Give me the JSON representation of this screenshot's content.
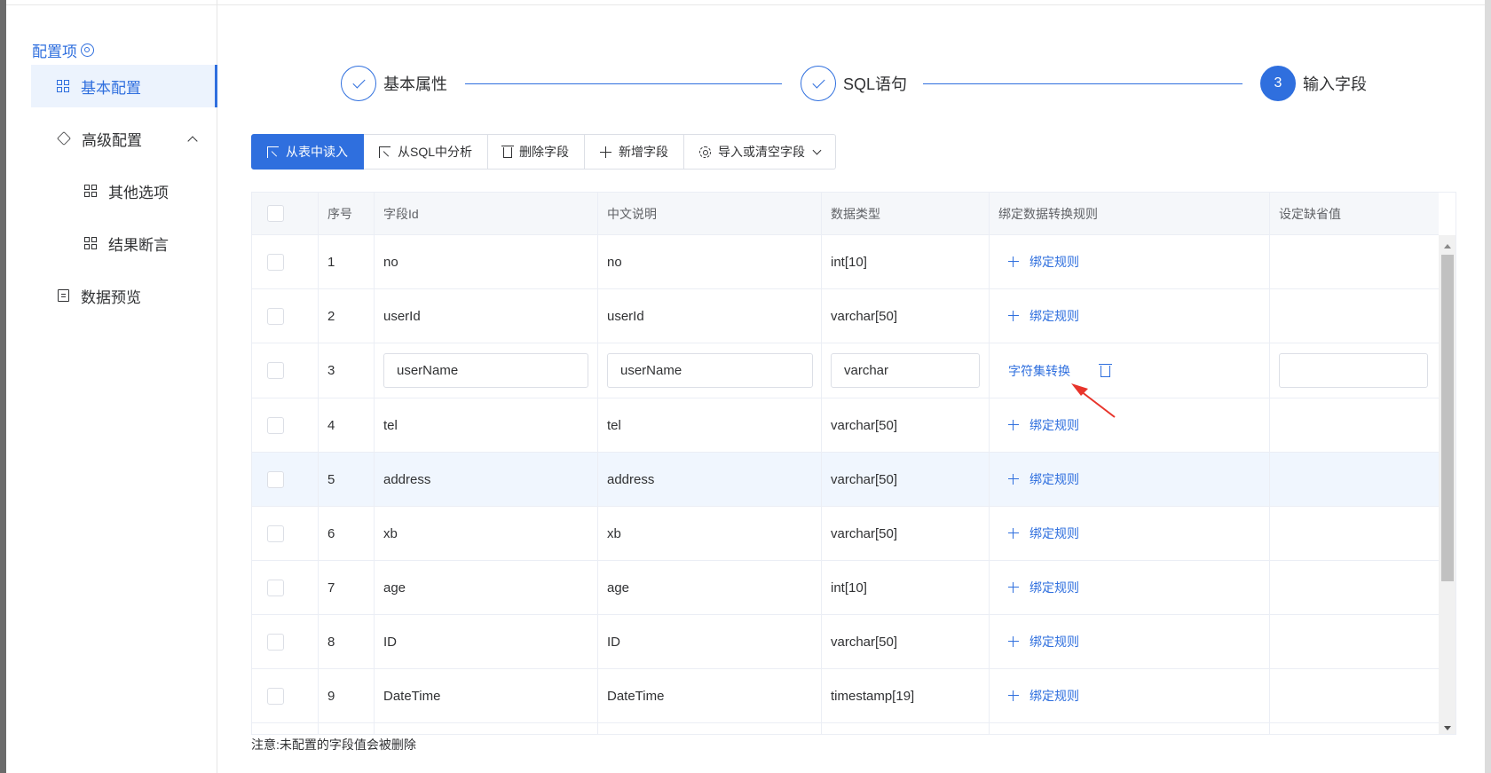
{
  "sidebar": {
    "title": "配置项",
    "items": [
      {
        "label": "基本配置"
      },
      {
        "label": "高级配置"
      },
      {
        "label": "其他选项"
      },
      {
        "label": "结果断言"
      },
      {
        "label": "数据预览"
      }
    ]
  },
  "steps": [
    {
      "label": "基本属性",
      "state": "done"
    },
    {
      "label": "SQL语句",
      "state": "done"
    },
    {
      "label": "输入字段",
      "state": "current",
      "number": "3"
    }
  ],
  "toolbar": {
    "read_table": "从表中读入",
    "from_sql": "从SQL中分析",
    "delete_field": "删除字段",
    "add_field": "新增字段",
    "import_clear": "导入或清空字段"
  },
  "table": {
    "headers": [
      "序号",
      "字段Id",
      "中文说明",
      "数据类型",
      "绑定数据转换规则",
      "设定缺省值"
    ],
    "bind_rule_label": "绑定规则",
    "rows": [
      {
        "no": "1",
        "field": "no",
        "desc": "no",
        "type": "int[10]"
      },
      {
        "no": "2",
        "field": "userId",
        "desc": "userId",
        "type": "varchar[50]"
      },
      {
        "no": "3",
        "field": "userName",
        "desc": "userName",
        "type": "varchar",
        "rule": "字符集转换",
        "default": ""
      },
      {
        "no": "4",
        "field": "tel",
        "desc": "tel",
        "type": "varchar[50]"
      },
      {
        "no": "5",
        "field": "address",
        "desc": "address",
        "type": "varchar[50]"
      },
      {
        "no": "6",
        "field": "xb",
        "desc": "xb",
        "type": "varchar[50]"
      },
      {
        "no": "7",
        "field": "age",
        "desc": "age",
        "type": "int[10]"
      },
      {
        "no": "8",
        "field": "ID",
        "desc": "ID",
        "type": "varchar[50]"
      },
      {
        "no": "9",
        "field": "DateTime",
        "desc": "DateTime",
        "type": "timestamp[19]"
      }
    ]
  },
  "note": "注意:未配置的字段值会被删除",
  "colors": {
    "accent": "#2f6fde",
    "highlight_row": "#f0f6fe",
    "annotation_arrow": "#e8342b"
  }
}
